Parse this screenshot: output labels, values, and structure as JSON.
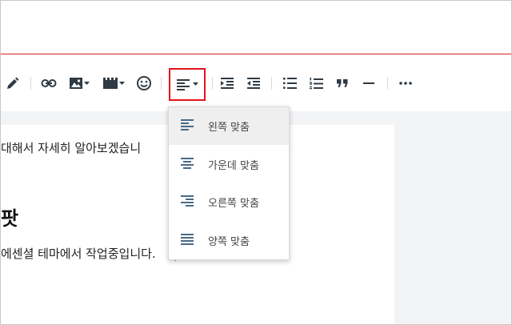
{
  "toolbar": {
    "items": [
      {
        "name": "pen-icon"
      },
      {
        "name": "link-icon"
      },
      {
        "name": "image-icon"
      },
      {
        "name": "video-icon"
      },
      {
        "name": "emoji-icon"
      },
      {
        "name": "align-left-icon"
      },
      {
        "name": "indent-icon"
      },
      {
        "name": "outdent-icon"
      },
      {
        "name": "bulleted-list-icon"
      },
      {
        "name": "numbered-list-icon"
      },
      {
        "name": "quote-icon"
      },
      {
        "name": "horizontal-rule-icon"
      },
      {
        "name": "more-icon"
      }
    ]
  },
  "document": {
    "line1": "대해서 자세히 알아보겠습니",
    "heading": "팟",
    "line2": "에센셜 테마에서 작업중입니다."
  },
  "align_menu": {
    "items": [
      {
        "label": "왼쪽 맞춤",
        "icon": "align-left-icon",
        "selected": true
      },
      {
        "label": "가운데 맞춤",
        "icon": "align-center-icon",
        "selected": false
      },
      {
        "label": "오른쪽 맞춤",
        "icon": "align-right-icon",
        "selected": false
      },
      {
        "label": "양쪽 맞춤",
        "icon": "align-justify-icon",
        "selected": false
      }
    ]
  },
  "colors": {
    "accent_red": "#e2151b",
    "toolbar_icon": "#2f3a44",
    "menu_icon": "#4a6a86"
  }
}
